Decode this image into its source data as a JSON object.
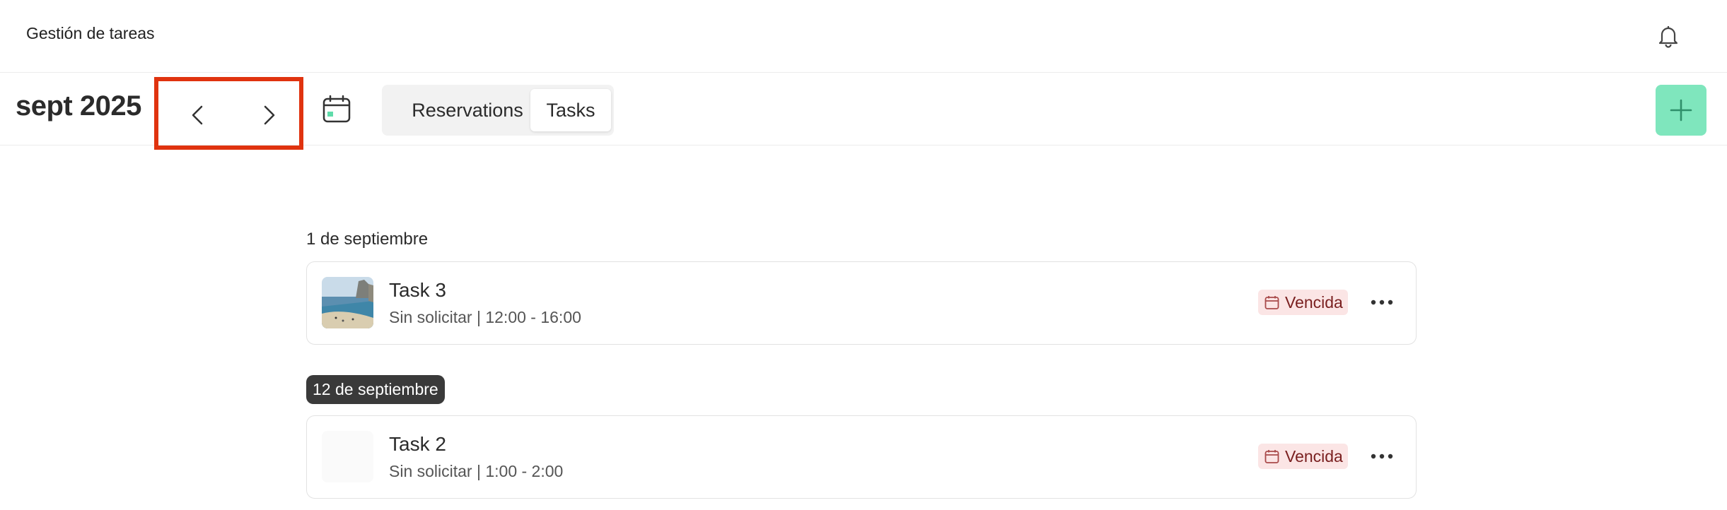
{
  "header": {
    "app_title": "Gestión de tareas",
    "bell_icon": "bell-icon"
  },
  "toolbar": {
    "month_label": "sept 2025",
    "prev_icon": "chevron-left-icon",
    "next_icon": "chevron-right-icon",
    "calendar_icon": "calendar-icon",
    "tabs": [
      {
        "label": "Reservations",
        "selected": false
      },
      {
        "label": "Tasks",
        "selected": true
      }
    ],
    "add_icon": "plus-icon",
    "add_color": "#7fe6bd"
  },
  "groups": [
    {
      "date_label": "1 de septiembre",
      "highlighted": false,
      "tasks": [
        {
          "title": "Task 3",
          "subtitle": "Sin solicitar | 12:00 - 16:00",
          "status": "Vencida",
          "has_image": true
        }
      ]
    },
    {
      "date_label": "12 de septiembre",
      "highlighted": true,
      "tasks": [
        {
          "title": "Task 2",
          "subtitle": "Sin solicitar | 1:00 - 2:00",
          "status": "Vencida",
          "has_image": false
        }
      ]
    }
  ],
  "colors": {
    "accent": "#7fe6bd",
    "overdue_bg": "#fbe5e5",
    "overdue_text": "#7a2020",
    "highlight_box": "#e0330f"
  }
}
